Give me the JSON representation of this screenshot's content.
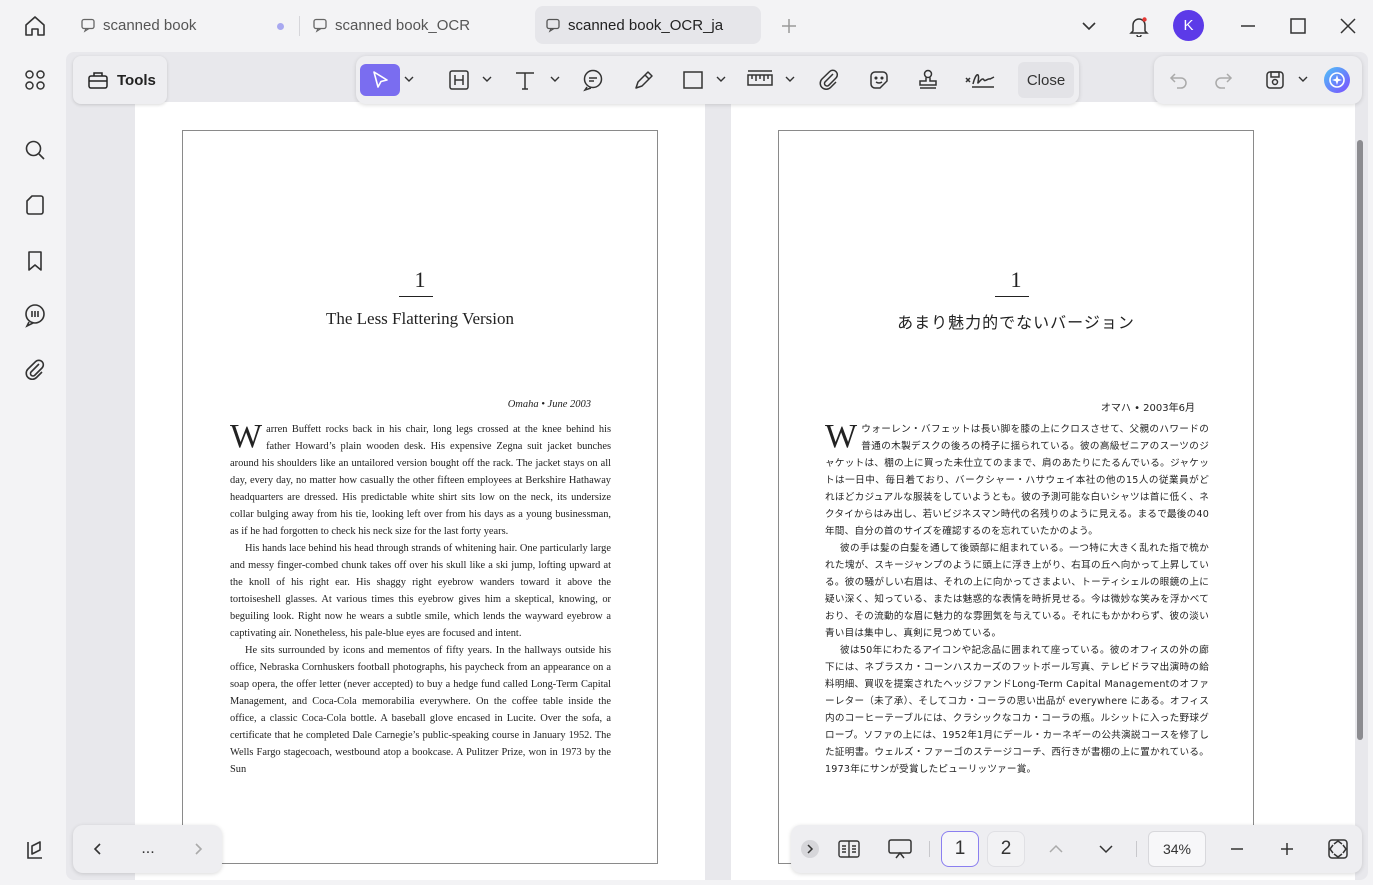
{
  "tabs": [
    {
      "label": "scanned book",
      "has_dot": true
    },
    {
      "label": "scanned book_OCR",
      "has_dot": false
    },
    {
      "label": "scanned book_OCR_ja",
      "active": true
    }
  ],
  "user": {
    "avatar_initial": "K",
    "avatar_color": "#5c3ae8"
  },
  "toolbar": {
    "tools_label": "Tools",
    "close_label": "Close",
    "accent_color": "#7a6df0"
  },
  "rail_icons": [
    "grid-icon",
    "search-icon",
    "page-icon",
    "bookmark-icon",
    "comment-icon",
    "attachment-icon",
    "layers-icon"
  ],
  "left_page": {
    "chapter_number": "1",
    "chapter_title": "The Less Flattering Version",
    "dateline": "Omaha • June 2003",
    "drop_cap": "W",
    "paragraph1_rest": "arren Buffett rocks back in his chair, long legs crossed at the knee behind his father Howard’s plain wooden desk. His expensive Zegna suit jacket bunches around his shoulders like an untailored version bought off the rack. The jacket stays on all day, every day, no matter how casually the other fifteen employees at Berkshire Hathaway headquarters are dressed. His predictable white shirt sits low on the neck, its undersize collar bulging away from his tie, looking left over from his days as a young businessman, as if he had forgotten to check his neck size for the last forty years.",
    "paragraph2": "His hands lace behind his head through strands of whitening hair. One particularly large and messy finger-combed chunk takes off over his skull like a ski jump, lofting upward at the knoll of his right ear. His shaggy right eyebrow wanders toward it above the tortoiseshell glasses. At various times this eyebrow gives him a skeptical, knowing, or beguiling look. Right now he wears a subtle smile, which lends the wayward eyebrow a captivating air. Nonetheless, his pale-blue eyes are focused and intent.",
    "paragraph3": "He sits surrounded by icons and mementos of fifty years. In the hallways outside his office, Nebraska Cornhuskers football photographs, his paycheck from an appearance on a soap opera, the offer letter (never accepted) to buy a hedge fund called Long-Term Capital Management, and Coca-Cola memorabilia everywhere. On the coffee table inside the office, a classic Coca-Cola bottle. A baseball glove encased in Lucite. Over the sofa, a certificate that he completed Dale Carnegie’s public-speaking course in January 1952. The Wells Fargo stagecoach, westbound atop a bookcase. A Pulitzer Prize, won in 1973 by the Sun"
  },
  "right_page": {
    "chapter_number": "1",
    "chapter_title": "あまり魅力的でないバージョン",
    "dateline": "オマハ • 2003年6月",
    "drop_cap": "W",
    "paragraph1_rest": "ウォーレン・バフェットは長い脚を膝の上にクロスさせて、父親のハワードの普通の木製デスクの後ろの椅子に揺られている。彼の高級ゼニアのスーツのジャケットは、棚の上に買った未仕立てのままで、肩のあたりにたるんでいる。ジャケットは一日中、毎日着ており、バークシャー・ハサウェイ本社の他の15人の従業員がどれほどカジュアルな服装をしていようとも。彼の予測可能な白いシャツは首に低く、ネクタイからはみ出し、若いビジネスマン時代の名残りのように見える。まるで最後の40年間、自分の首のサイズを確認するのを忘れていたかのよう。",
    "paragraph2": "彼の手は髪の白髪を通して後頭部に組まれている。一つ特に大きく乱れた指で梳かれた塊が、スキージャンプのように頭上に浮き上がり、右耳の丘へ向かって上昇している。彼の騒がしい右眉は、それの上に向かってさまよい、トーティシェルの眼鏡の上に疑い深く、知っている、または魅惑的な表情を時折見せる。今は微妙な笑みを浮かべており、その流動的な眉に魅力的な雰囲気を与えている。それにもかかわらず、彼の淡い青い目は集中し、真剣に見つめている。",
    "paragraph3": "彼は50年にわたるアイコンや記念品に囲まれて座っている。彼のオフィスの外の廊下には、ネブラスカ・コーンハスカーズのフットボール写真、テレビドラマ出演時の給料明細、買収を提案されたヘッジファンドLong-Term Capital Managementのオファーレター（未了承）、そしてコカ・コーラの思い出品が everywhere にある。オフィス内のコーヒーテーブルには、クラシックなコカ・コーラの瓶。ルシットに入った野球グローブ。ソファの上には、1952年1月にデール・カーネギーの公共演説コースを修了した証明書。ウェルズ・ファーゴのステージコーチ、西行きが書棚の上に置かれている。1973年にサンが受賞したピューリッツァー賞。"
  },
  "pagination": {
    "pages": [
      "1",
      "2"
    ],
    "current": "1",
    "zoom": "34%",
    "nav_more": "..."
  }
}
